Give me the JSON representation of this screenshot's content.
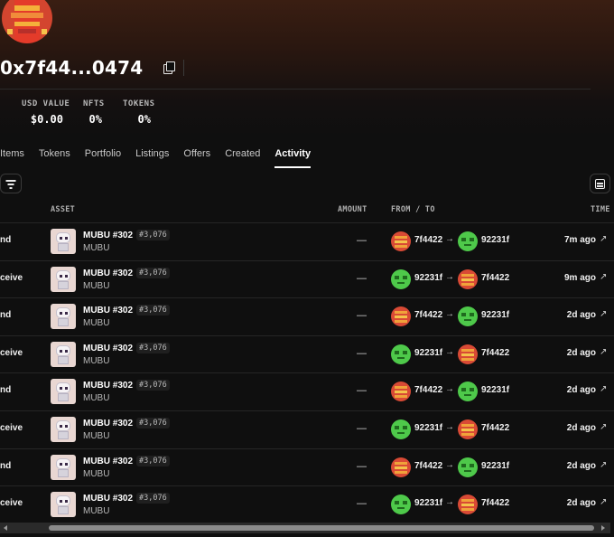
{
  "profile": {
    "address": "0x7f44...0474",
    "icons": {
      "avatar": "pixel-avatar",
      "copy": "copy-icon"
    }
  },
  "stats": [
    {
      "label": "USD VALUE",
      "value": "$0.00"
    },
    {
      "label": "NFTS",
      "value": "0%"
    },
    {
      "label": "TOKENS",
      "value": "0%"
    }
  ],
  "tabs": [
    {
      "label": "Items",
      "active": false
    },
    {
      "label": "Tokens",
      "active": false
    },
    {
      "label": "Portfolio",
      "active": false
    },
    {
      "label": "Listings",
      "active": false
    },
    {
      "label": "Offers",
      "active": false
    },
    {
      "label": "Created",
      "active": false
    },
    {
      "label": "Activity",
      "active": true
    }
  ],
  "toolbar": {
    "filter_icon": "filter-icon",
    "view_icon": "table-view-icon"
  },
  "table": {
    "columns": {
      "asset": "ASSET",
      "amount": "AMOUNT",
      "from_to": "FROM / TO",
      "time": "TIME"
    },
    "rows": [
      {
        "event": "nd",
        "asset_name": "MUBU #302",
        "rank": "#3,076",
        "collection": "MUBU",
        "amount": "—",
        "from": "7f4422",
        "from_avatar": "red",
        "arrow": "→",
        "to": "92231f",
        "to_avatar": "green",
        "time": "7m ago"
      },
      {
        "event": "ceive",
        "asset_name": "MUBU #302",
        "rank": "#3,076",
        "collection": "MUBU",
        "amount": "—",
        "from": "92231f",
        "from_avatar": "green",
        "arrow": "→",
        "to": "7f4422",
        "to_avatar": "red",
        "time": "9m ago"
      },
      {
        "event": "nd",
        "asset_name": "MUBU #302",
        "rank": "#3,076",
        "collection": "MUBU",
        "amount": "—",
        "from": "7f4422",
        "from_avatar": "red",
        "arrow": "→",
        "to": "92231f",
        "to_avatar": "green",
        "time": "2d ago"
      },
      {
        "event": "ceive",
        "asset_name": "MUBU #302",
        "rank": "#3,076",
        "collection": "MUBU",
        "amount": "—",
        "from": "92231f",
        "from_avatar": "green",
        "arrow": "→",
        "to": "7f4422",
        "to_avatar": "red",
        "time": "2d ago"
      },
      {
        "event": "nd",
        "asset_name": "MUBU #302",
        "rank": "#3,076",
        "collection": "MUBU",
        "amount": "—",
        "from": "7f4422",
        "from_avatar": "red",
        "arrow": "→",
        "to": "92231f",
        "to_avatar": "green",
        "time": "2d ago"
      },
      {
        "event": "ceive",
        "asset_name": "MUBU #302",
        "rank": "#3,076",
        "collection": "MUBU",
        "amount": "—",
        "from": "92231f",
        "from_avatar": "green",
        "arrow": "→",
        "to": "7f4422",
        "to_avatar": "red",
        "time": "2d ago"
      },
      {
        "event": "nd",
        "asset_name": "MUBU #302",
        "rank": "#3,076",
        "collection": "MUBU",
        "amount": "—",
        "from": "7f4422",
        "from_avatar": "red",
        "arrow": "→",
        "to": "92231f",
        "to_avatar": "green",
        "time": "2d ago"
      },
      {
        "event": "ceive",
        "asset_name": "MUBU #302",
        "rank": "#3,076",
        "collection": "MUBU",
        "amount": "—",
        "from": "92231f",
        "from_avatar": "green",
        "arrow": "→",
        "to": "7f4422",
        "to_avatar": "red",
        "time": "2d ago"
      }
    ],
    "ext_icon": "↗"
  },
  "colors": {
    "background": "#0f0f0f",
    "red_avatar": "#d94a35",
    "green_avatar": "#4ec94a"
  }
}
